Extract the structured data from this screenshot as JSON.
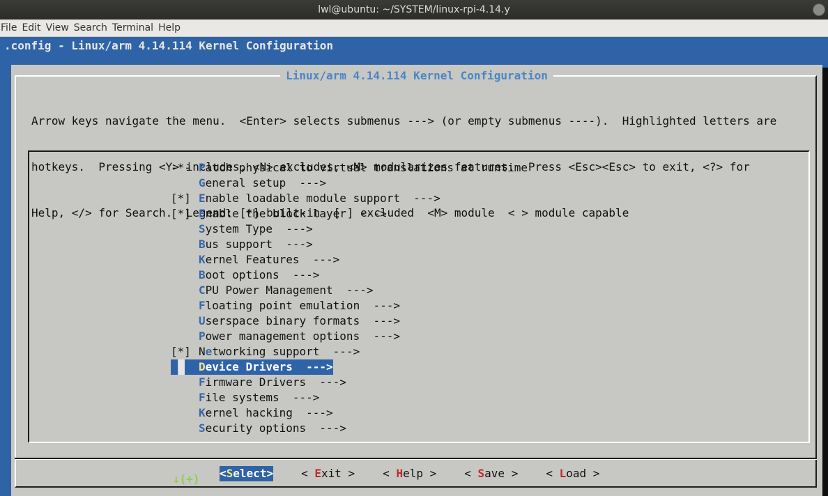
{
  "window": {
    "title": "lwl@ubuntu: ~/SYSTEM/linux-rpi-4.14.y"
  },
  "menubar": [
    "File",
    "Edit",
    "View",
    "Search",
    "Terminal",
    "Help"
  ],
  "terminal": {
    "config_line": ".config - Linux/arm 4.14.114 Kernel Configuration"
  },
  "dialog": {
    "title": "Linux/arm 4.14.114 Kernel Configuration",
    "help_lines": [
      "Arrow keys navigate the menu.  <Enter> selects submenus ---> (or empty submenus ----).  Highlighted letters are",
      "hotkeys.  Pressing <Y> includes, <N> excludes, <M> modularizes features.  Press <Esc><Esc> to exit, <?> for",
      "Help, </> for Search.  Legend: [*] built-in  [ ] excluded  <M> module  < > module capable"
    ],
    "more_indicator": "↓(+)",
    "menu_items": [
      {
        "prefix": "-*- ",
        "hot": "P",
        "rest": "atch physical to virtual translations at runtime"
      },
      {
        "prefix": "    ",
        "hot": "G",
        "rest": "eneral setup  --->"
      },
      {
        "prefix": "[*] ",
        "hot": "E",
        "rest": "nable loadable module support  --->"
      },
      {
        "prefix": "[*] ",
        "hot": "E",
        "rest": "nable the block layer  --->"
      },
      {
        "prefix": "    ",
        "hot": "S",
        "rest": "ystem Type  --->"
      },
      {
        "prefix": "    ",
        "hot": "B",
        "rest": "us support  --->"
      },
      {
        "prefix": "    ",
        "hot": "K",
        "rest": "ernel Features  --->"
      },
      {
        "prefix": "    ",
        "hot": "B",
        "rest": "oot options  --->"
      },
      {
        "prefix": "    ",
        "hot": "C",
        "rest": "PU Power Management  --->"
      },
      {
        "prefix": "    ",
        "hot": "F",
        "rest": "loating point emulation  --->"
      },
      {
        "prefix": "    ",
        "hot": "U",
        "rest": "serspace binary formats  --->"
      },
      {
        "prefix": "    ",
        "hot": "P",
        "rest": "ower management options  --->"
      },
      {
        "prefix": "[*] ",
        "pre": "N",
        "hot": "e",
        "rest": "tworking support  --->"
      },
      {
        "prefix": "    ",
        "hot": "D",
        "rest": "evice Drivers  --->",
        "selected": true
      },
      {
        "prefix": "    ",
        "hot": "F",
        "rest": "irmware Drivers  --->"
      },
      {
        "prefix": "    ",
        "hot": "F",
        "rest": "ile systems  --->"
      },
      {
        "prefix": "    ",
        "hot": "K",
        "rest": "ernel hacking  --->"
      },
      {
        "prefix": "    ",
        "hot": "S",
        "rest": "ecurity options  --->"
      }
    ],
    "buttons": [
      {
        "open": "<",
        "hot": "S",
        "rest": "elect",
        "close": ">",
        "active": true
      },
      {
        "open": "< ",
        "hot": "E",
        "rest": "xit",
        "close": " >"
      },
      {
        "open": "< ",
        "hot": "H",
        "rest": "elp",
        "close": " >"
      },
      {
        "open": "< ",
        "hot": "S",
        "rest": "ave",
        "close": " >"
      },
      {
        "open": "< ",
        "hot": "L",
        "rest": "oad",
        "close": " >"
      }
    ]
  },
  "colors": {
    "terminal_bg": "#2f63a7",
    "dialog_bg": "#c7c7c3",
    "title_color": "#4a86c6",
    "hotkey_menu": "#3b66a8",
    "hotkey_button": "#c02a2a",
    "more_indicator": "#8ad14a"
  }
}
